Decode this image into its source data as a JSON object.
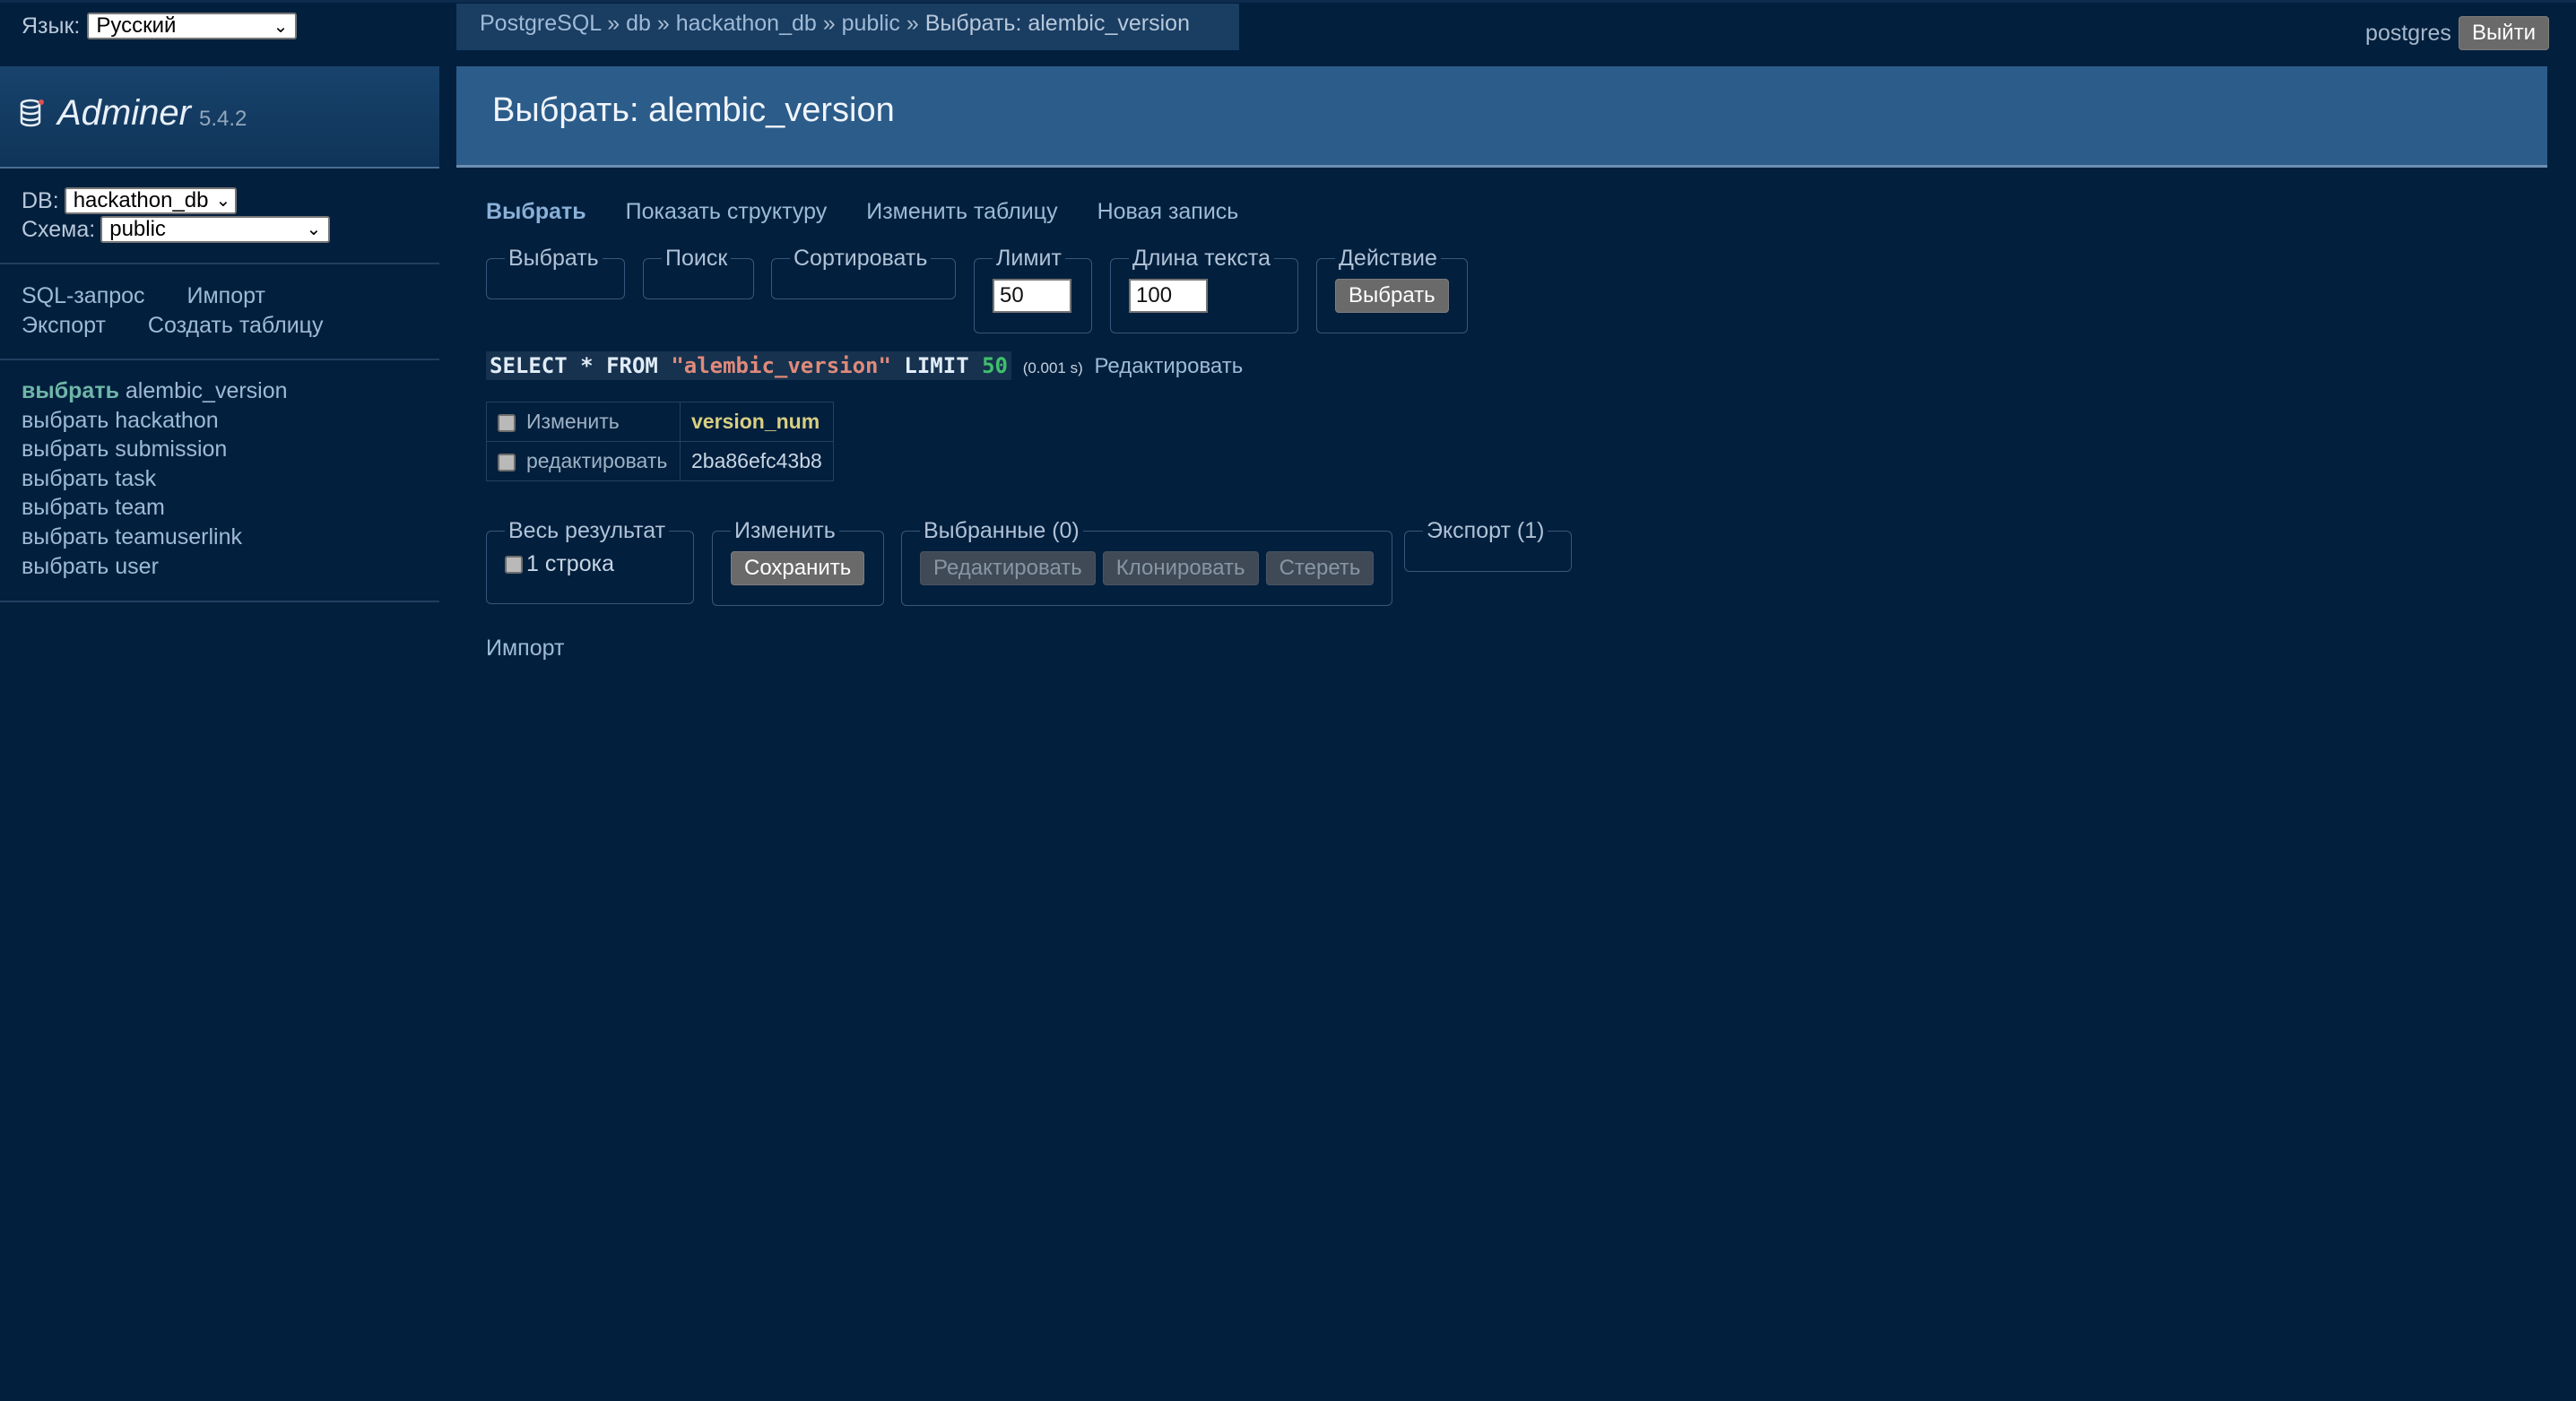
{
  "lang": {
    "label": "Язык:",
    "selected": "Русский"
  },
  "breadcrumb": {
    "items": [
      "PostgreSQL",
      "db",
      "hackathon_db",
      "public"
    ],
    "sep": "»",
    "current": "Выбрать: alembic_version"
  },
  "user": {
    "name": "postgres",
    "logout": "Выйти"
  },
  "sidebar": {
    "brand": "Adminer",
    "version": "5.4.2",
    "db_label": "DB:",
    "db_value": "hackathon_db",
    "schema_label": "Схема:",
    "schema_value": "public",
    "commands": {
      "sql": "SQL-запрос",
      "import": "Импорт",
      "export": "Экспорт",
      "create": "Создать таблицу"
    },
    "select_word": "выбрать",
    "tables": [
      "alembic_version",
      "hackathon",
      "submission",
      "task",
      "team",
      "teamuserlink",
      "user"
    ]
  },
  "page": {
    "title": "Выбрать: alembic_version"
  },
  "tabs": [
    "Выбрать",
    "Показать структуру",
    "Изменить таблицу",
    "Новая запись"
  ],
  "filters": {
    "select": "Выбрать",
    "search": "Поиск",
    "sort": "Сортировать",
    "limit_label": "Лимит",
    "limit_value": "50",
    "textlen_label": "Длина текста",
    "textlen_value": "100",
    "action_label": "Действие",
    "action_button": "Выбрать"
  },
  "query": {
    "kw_select": "SELECT",
    "star": "*",
    "kw_from": "FROM",
    "table": "\"alembic_version\"",
    "kw_limit": "LIMIT",
    "limit": "50",
    "time": "(0.001 s)",
    "edit": "Редактировать"
  },
  "results": {
    "header_check_label": "Изменить",
    "column": "version_num",
    "rows": [
      {
        "edit": "редактировать",
        "value": "2ba86efc43b8"
      }
    ]
  },
  "bottom": {
    "whole_legend": "Весь результат",
    "whole_count": "1 строка",
    "modify_legend": "Изменить",
    "save": "Сохранить",
    "selected_legend": "Выбранные (0)",
    "edit": "Редактировать",
    "clone": "Клонировать",
    "delete": "Стереть",
    "export_legend": "Экспорт (1)",
    "import": "Импорт"
  },
  "colors": {
    "background": "#021f3d",
    "header": "#2c5c8a",
    "link": "#9fbad6",
    "sql_string": "#e08a7a",
    "sql_number": "#3fc06b",
    "active_table": "#6fb6a9"
  }
}
